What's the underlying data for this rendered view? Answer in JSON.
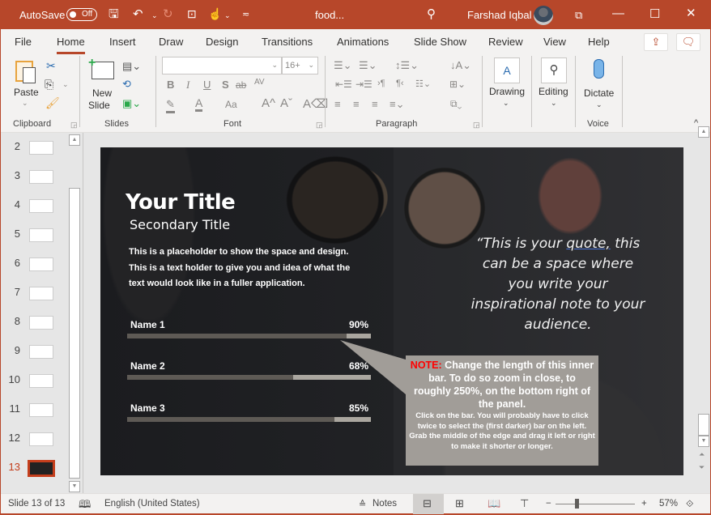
{
  "titlebar": {
    "autosave_label": "AutoSave",
    "autosave_state": "Off",
    "filename": "food...",
    "user_name": "Farshad Iqbal",
    "icons": [
      "save-icon",
      "undo-icon",
      "redo-icon",
      "present-from-start-icon",
      "touch-mode-icon",
      "customize-qat-icon",
      "search-icon",
      "ribbon-display-icon",
      "minimize-icon",
      "maximize-icon",
      "close-icon"
    ]
  },
  "ribbon": {
    "tabs": [
      "File",
      "Home",
      "Insert",
      "Draw",
      "Design",
      "Transitions",
      "Animations",
      "Slide Show",
      "Review",
      "View",
      "Help"
    ],
    "active_tab": "Home",
    "share_icon": "share-icon",
    "comments_icon": "comments-icon",
    "groups": {
      "clipboard": {
        "label": "Clipboard",
        "paste": "Paste"
      },
      "slides": {
        "label": "Slides",
        "new_slide_line1": "New",
        "new_slide_line2": "Slide"
      },
      "font": {
        "label": "Font",
        "font_name": "",
        "font_size": "16+",
        "buttons": [
          "B",
          "I",
          "U",
          "S",
          "ab",
          "AV",
          "Aa",
          "A^",
          "Aˇ"
        ]
      },
      "paragraph": {
        "label": "Paragraph"
      },
      "drawing": {
        "label": "Drawing"
      },
      "editing": {
        "label": "Editing"
      },
      "voice": {
        "label": "Voice",
        "dictate": "Dictate"
      }
    }
  },
  "thumbnails": {
    "items": [
      {
        "number": "2"
      },
      {
        "number": "3"
      },
      {
        "number": "4"
      },
      {
        "number": "5"
      },
      {
        "number": "6"
      },
      {
        "number": "7"
      },
      {
        "number": "8"
      },
      {
        "number": "9"
      },
      {
        "number": "10"
      },
      {
        "number": "11"
      },
      {
        "number": "12"
      },
      {
        "number": "13",
        "selected": true
      }
    ]
  },
  "slide": {
    "title": "Your Title",
    "subtitle": "Secondary Title",
    "body": "This is a placeholder to show the space and design. This is a text holder to give you and idea of what the text would look like in a fuller application.",
    "bars": [
      {
        "name": "Name 1",
        "label": "90%",
        "value": 0.9
      },
      {
        "name": "Name 2",
        "label": "68%",
        "value": 0.68
      },
      {
        "name": "Name 3",
        "label": "85%",
        "value": 0.85
      }
    ],
    "quote_open": "“This is your",
    "quote_link": "quote,",
    "quote_rest": " this can be a space where you write your inspirational note to your audience.",
    "note_prefix": "NOTE:",
    "note_main": " Change the length of this inner bar. To do so zoom in close, to roughly 250%, on the bottom right of the panel.",
    "note_detail": "Click on the bar. You will probably have to click twice to select the (first darker) bar on the left. Grab the middle of the edge and drag it left or right to make it shorter or longer.",
    "colors": {
      "note_red": "#ff0000",
      "bar_dark": "#5e5a55",
      "bar_light": "#aaa69f",
      "note_bg": "#a19d98"
    }
  },
  "statusbar": {
    "slide_indicator": "Slide 13 of 13",
    "language": "English (United States)",
    "notes": "Notes",
    "zoom_minus": "−",
    "zoom_plus": "+",
    "zoom_level": "57%",
    "zoom_fraction": 0.57
  },
  "theme": {
    "accent": "#b7472a"
  }
}
